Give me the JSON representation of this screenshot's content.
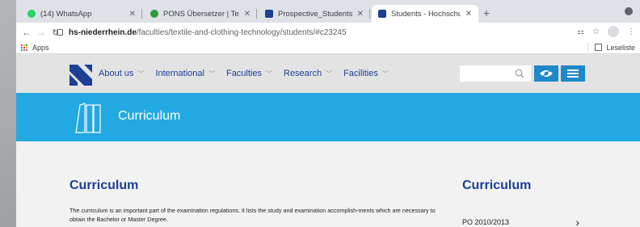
{
  "browser": {
    "tabs": [
      {
        "title": "(14) WhatsApp",
        "favicon_color": "#25d366",
        "active": false
      },
      {
        "title": "PONS Übersetzer | Textüberse",
        "favicon_color": "#2e9b3c",
        "active": false
      },
      {
        "title": "Prospective_Students - Hochs",
        "favicon_color": "#1c3f94",
        "active": false
      },
      {
        "title": "Students - Hochschule Nieder",
        "favicon_color": "#1c3f94",
        "active": true
      }
    ],
    "new_tab_label": "+",
    "address": {
      "host": "hs-niederrhein.de",
      "path": "/faculties/textile-and-clothing-technology/students/#c23245"
    },
    "bookmarks": {
      "apps_label": "Apps",
      "reading_list_label": "Leseliste"
    }
  },
  "site": {
    "nav": [
      {
        "label": "About us"
      },
      {
        "label": "International"
      },
      {
        "label": "Faculties"
      },
      {
        "label": "Research"
      },
      {
        "label": "Facilities"
      }
    ],
    "search_placeholder": "",
    "brand_color": "#1c3f94",
    "accent_color": "#23a9e1",
    "banner": {
      "title": "Curriculum"
    },
    "main": {
      "heading": "Curriculum",
      "text": "The curriculum is an important part of the examination regulations. It lists the study and examination accomplish-ments which are necessary to obtain the Bachelor or Master Degree."
    },
    "sidebar": {
      "heading": "Curriculum",
      "links": [
        {
          "label": "PO 2010/2013"
        }
      ]
    }
  }
}
